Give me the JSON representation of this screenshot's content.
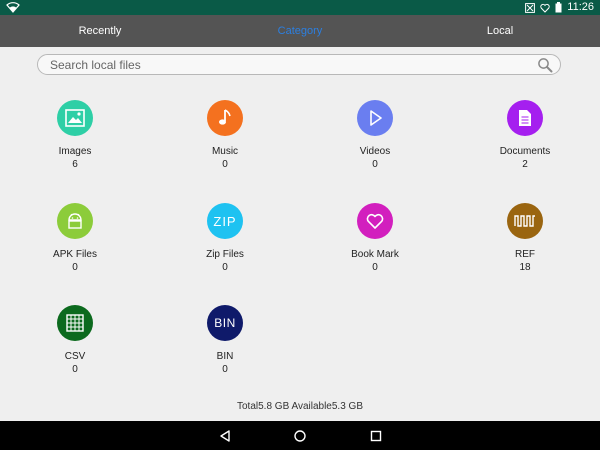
{
  "status_bar": {
    "time": "11:26"
  },
  "tabs": [
    {
      "label": "Recently",
      "active": false
    },
    {
      "label": "Category",
      "active": true
    },
    {
      "label": "Local",
      "active": false
    }
  ],
  "search": {
    "placeholder": "Search local files",
    "value": ""
  },
  "categories": [
    {
      "name": "Images",
      "count": "6",
      "icon": "image-icon",
      "color": "#2ecfa6"
    },
    {
      "name": "Music",
      "count": "0",
      "icon": "music-note-icon",
      "color": "#f4711f"
    },
    {
      "name": "Videos",
      "count": "0",
      "icon": "play-icon",
      "color": "#6a7ef0"
    },
    {
      "name": "Documents",
      "count": "2",
      "icon": "document-icon",
      "color": "#a51fef"
    },
    {
      "name": "APK Files",
      "count": "0",
      "icon": "android-icon",
      "color": "#8ccc3a"
    },
    {
      "name": "Zip Files",
      "count": "0",
      "icon": "zip-icon",
      "color": "#1ec2f1",
      "glyph": "ZIP"
    },
    {
      "name": "Book Mark",
      "count": "0",
      "icon": "heart-icon",
      "color": "#d21fbe"
    },
    {
      "name": "REF",
      "count": "18",
      "icon": "waveform-icon",
      "color": "#9a6510"
    },
    {
      "name": "CSV",
      "count": "0",
      "icon": "spreadsheet-icon",
      "color": "#0c6a1e"
    },
    {
      "name": "BIN",
      "count": "0",
      "icon": "bin-icon",
      "color": "#0f1a6a",
      "glyph": "BIN"
    }
  ],
  "storage": {
    "text": "Total5.8 GB Available5.3 GB"
  },
  "colors": {
    "status_bar": "#0a5a47",
    "tab_bar": "#545454",
    "active_tab": "#2c7fe0",
    "background": "#efefef"
  }
}
